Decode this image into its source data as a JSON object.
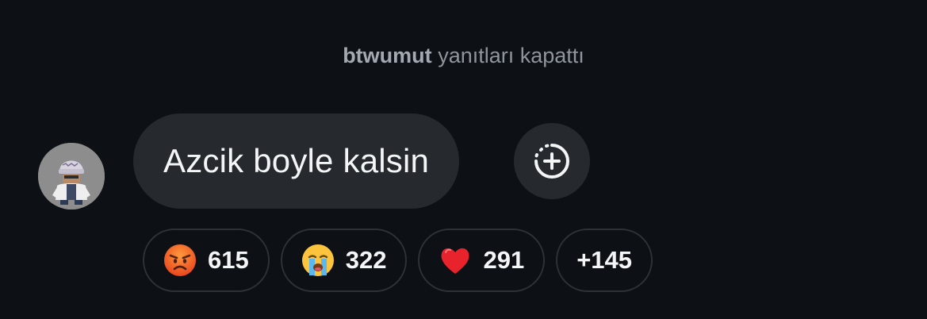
{
  "notice": {
    "username": "btwumut",
    "text": "yanıtları kapattı"
  },
  "message": {
    "text": "Azcik boyle kalsin"
  },
  "add_reaction": {
    "icon": "add-reaction-icon"
  },
  "reactions": [
    {
      "emoji": "angry-face-icon",
      "count": "615"
    },
    {
      "emoji": "loudly-crying-face-icon",
      "count": "322"
    },
    {
      "emoji": "red-heart-icon",
      "count": "291"
    },
    {
      "emoji": "",
      "count": "+145"
    }
  ],
  "colors": {
    "background": "#0d1014",
    "bubble": "#262a2f",
    "chip_border": "#2d3238",
    "notice_text": "#8f959c",
    "text": "#f3f5f7"
  }
}
